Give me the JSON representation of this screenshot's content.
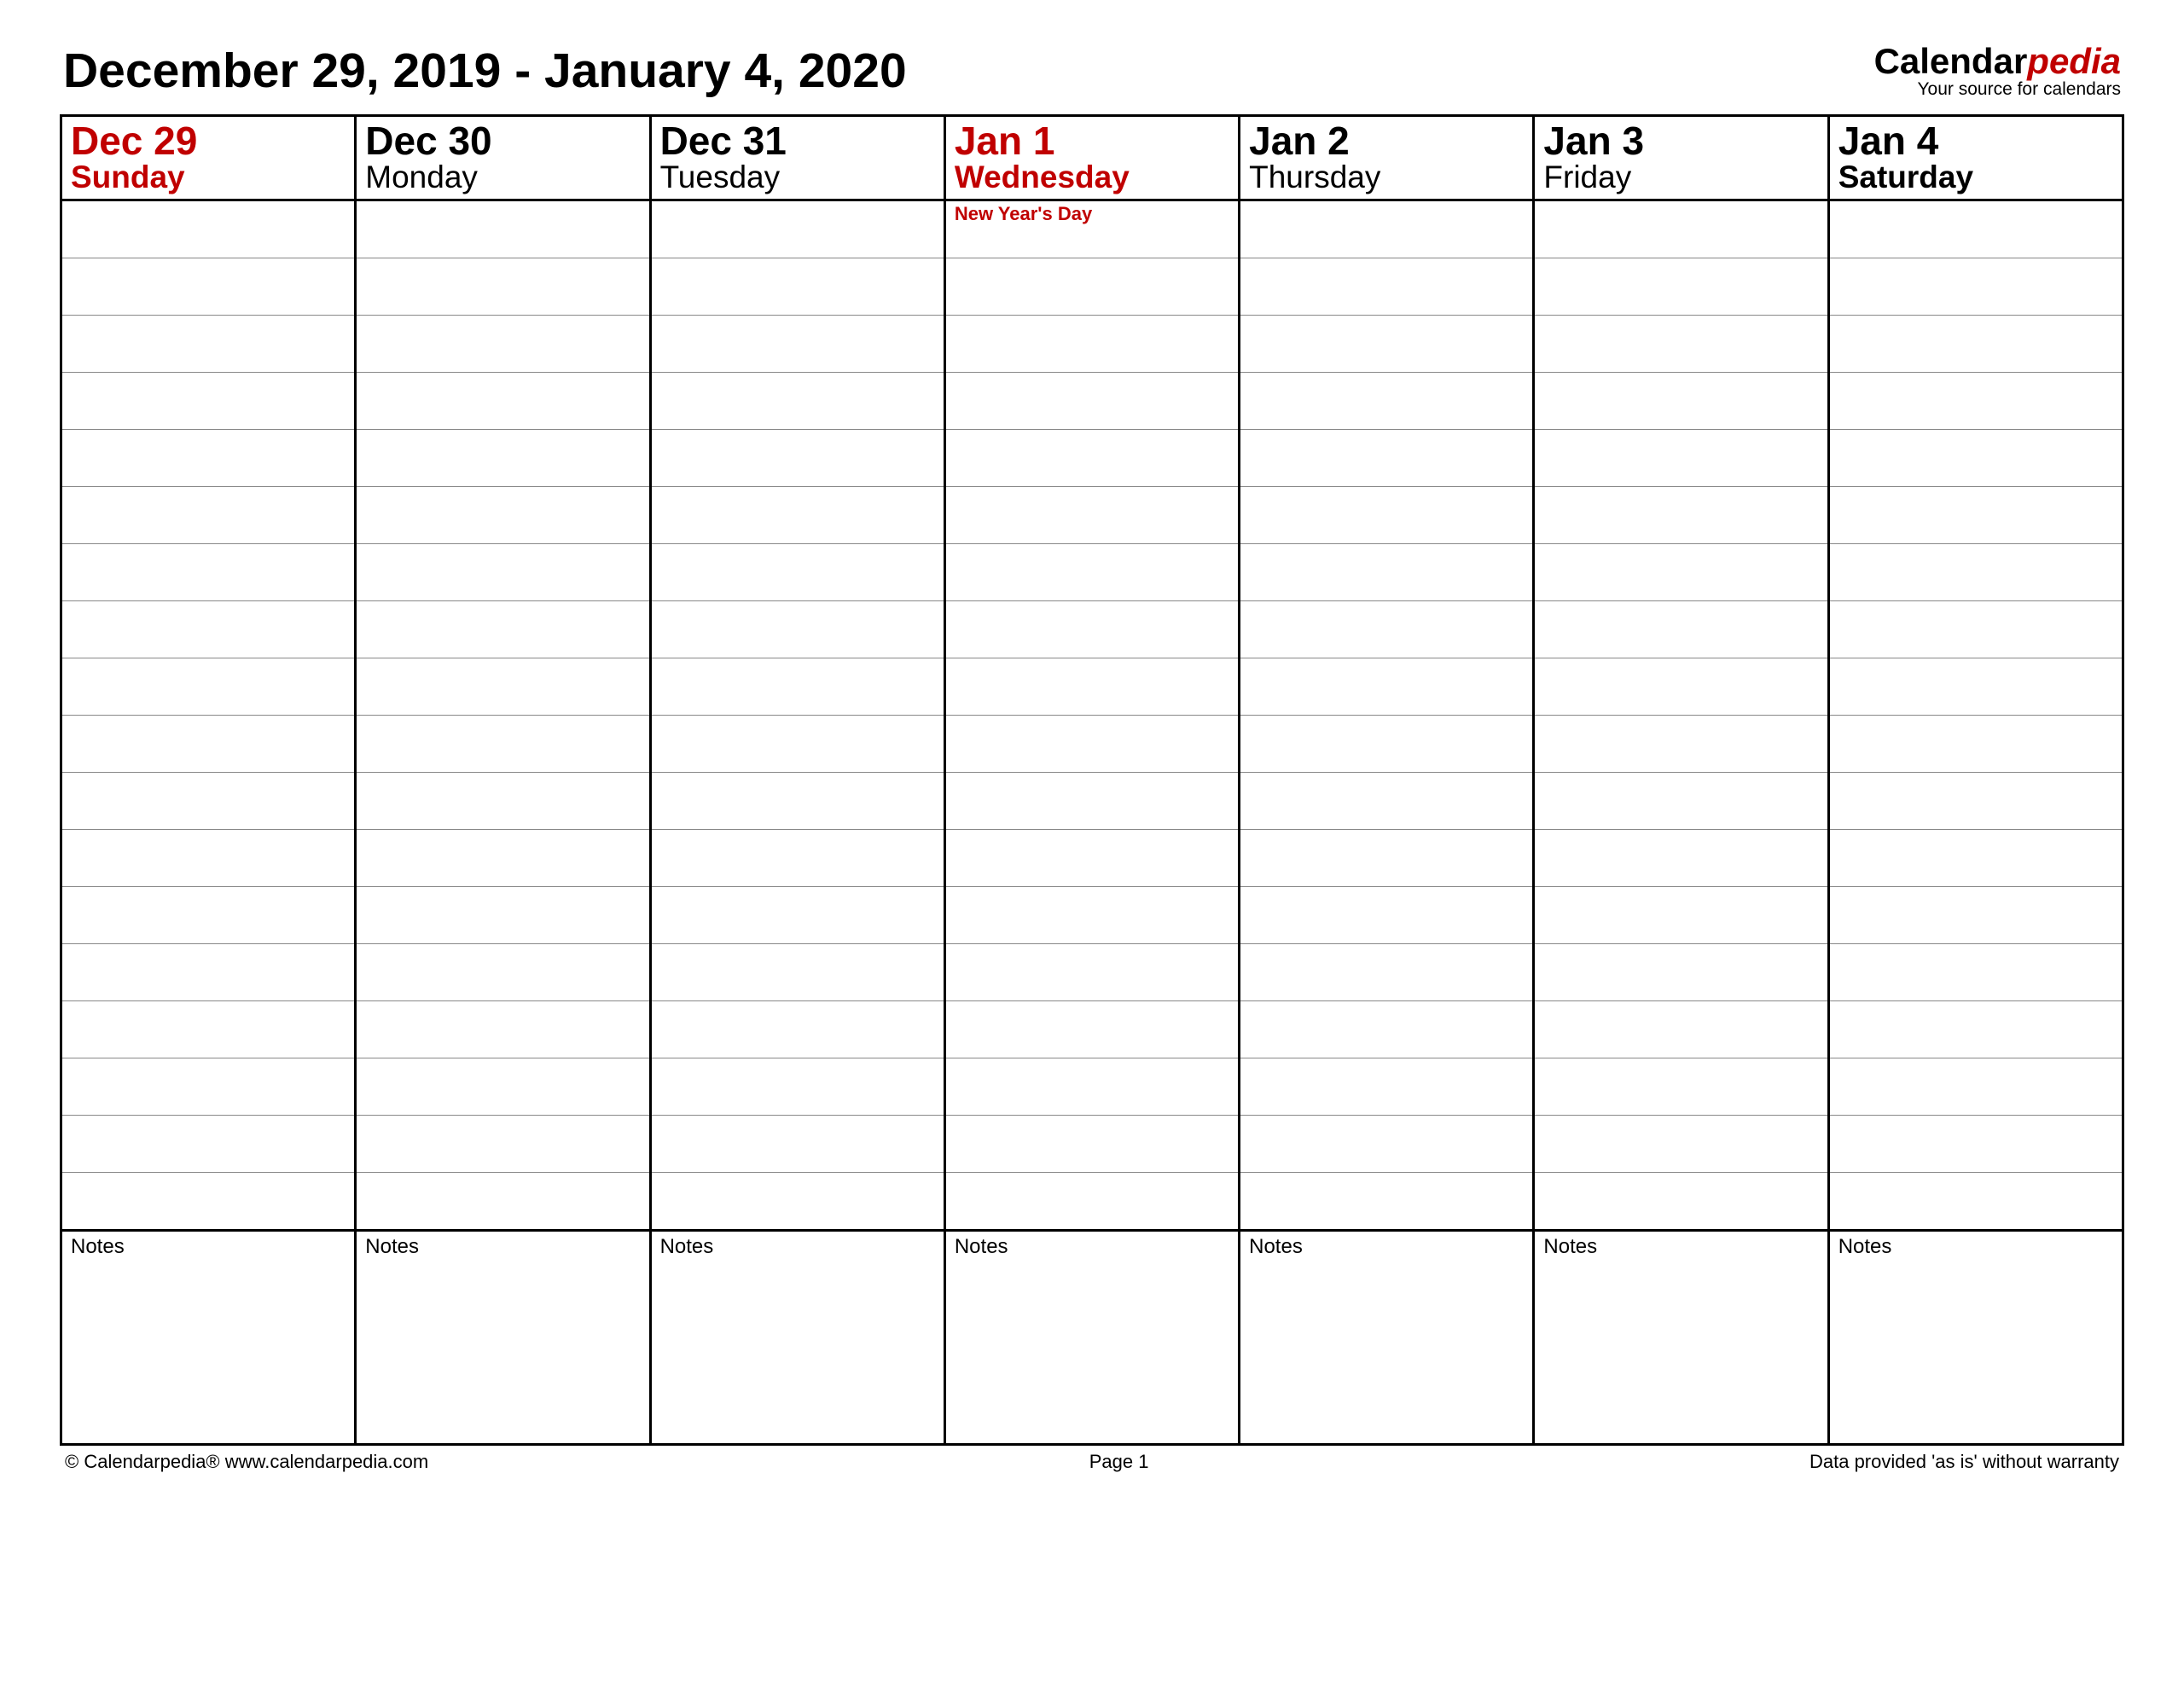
{
  "title": "December 29, 2019 - January 4, 2020",
  "brand": {
    "prefix": "Calendar",
    "suffix": "pedia",
    "tagline": "Your source for calendars"
  },
  "days": [
    {
      "date": "Dec 29",
      "weekday": "Sunday",
      "highlight": true,
      "bold": true,
      "event": ""
    },
    {
      "date": "Dec 30",
      "weekday": "Monday",
      "highlight": false,
      "bold": false,
      "event": ""
    },
    {
      "date": "Dec 31",
      "weekday": "Tuesday",
      "highlight": false,
      "bold": false,
      "event": ""
    },
    {
      "date": "Jan 1",
      "weekday": "Wednesday",
      "highlight": true,
      "bold": true,
      "event": "New Year's Day"
    },
    {
      "date": "Jan 2",
      "weekday": "Thursday",
      "highlight": false,
      "bold": false,
      "event": ""
    },
    {
      "date": "Jan 3",
      "weekday": "Friday",
      "highlight": false,
      "bold": false,
      "event": ""
    },
    {
      "date": "Jan 4",
      "weekday": "Saturday",
      "highlight": false,
      "bold": true,
      "event": ""
    }
  ],
  "slot_rows": 18,
  "notes_label": "Notes",
  "footer": {
    "left": "© Calendarpedia®   www.calendarpedia.com",
    "center": "Page 1",
    "right": "Data provided 'as is' without warranty"
  }
}
